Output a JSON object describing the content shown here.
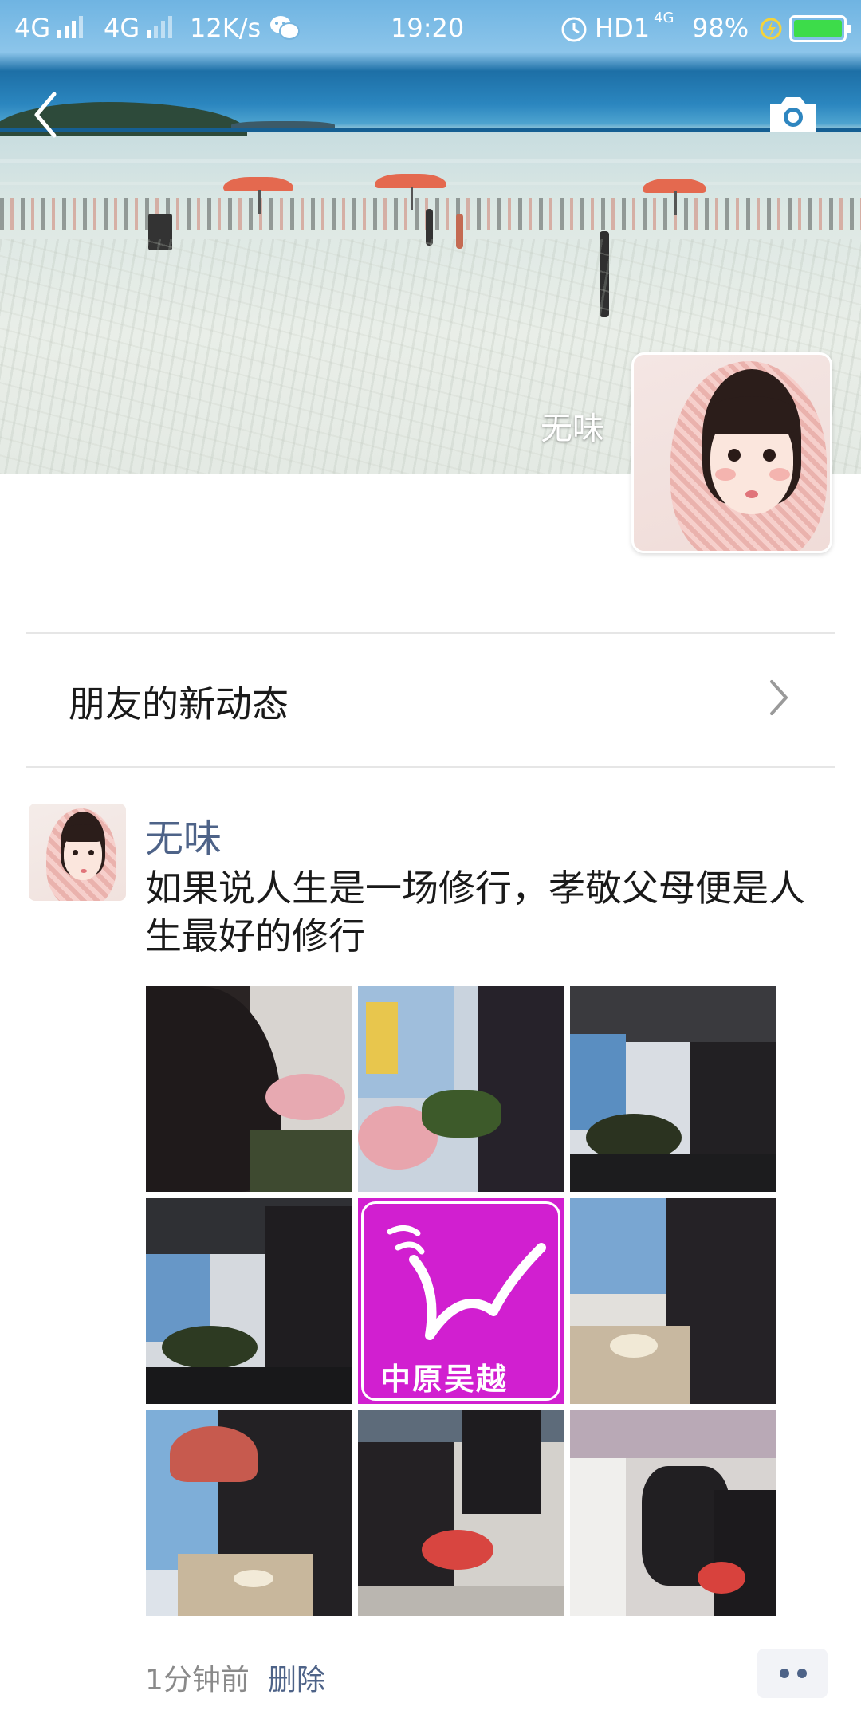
{
  "status_bar": {
    "network_1": "4G",
    "network_2": "4G",
    "speed": "12K/s",
    "time": "19:20",
    "hd_label": "HD1",
    "hd_sub": "4G",
    "battery": "98%",
    "icons": [
      "signal-icon",
      "wechat-icon",
      "alarm-icon",
      "charging-icon",
      "battery-icon"
    ]
  },
  "cover": {
    "name": "无味",
    "back_icon": "chevron-left-icon",
    "camera_icon": "camera-icon"
  },
  "friends_row": {
    "label": "朋友的新动态",
    "icon": "chevron-right-icon"
  },
  "post": {
    "author": "无味",
    "text": "如果说人生是一场修行，孝敬父母便是人生最好的修行",
    "logo_text": "中原吴越",
    "time": "1分钟前",
    "delete_label": "删除",
    "more_icon": "more-dots-icon"
  },
  "colors": {
    "link_blue": "#4e6388",
    "logo_magenta": "#d11fd0",
    "battery_green": "#3ddc4a"
  }
}
